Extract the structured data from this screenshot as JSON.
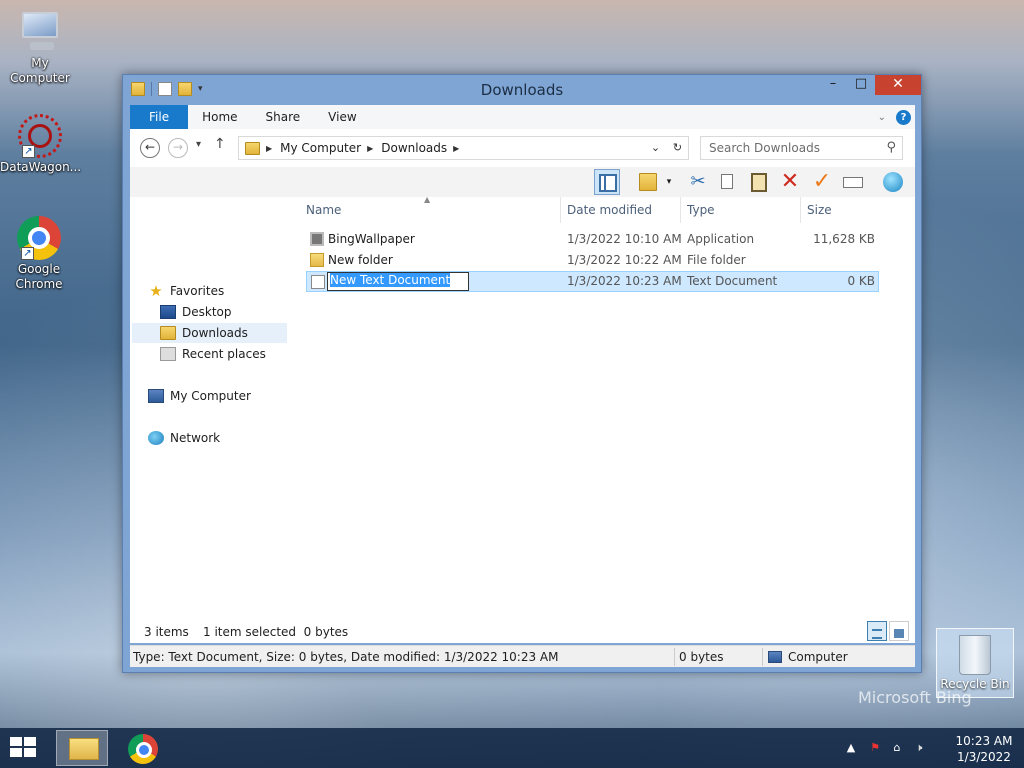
{
  "desktop": {
    "icons": [
      {
        "label": "My Computer"
      },
      {
        "label": "DataWagon..."
      },
      {
        "label": "Google Chrome"
      }
    ],
    "recycle_bin": "Recycle Bin",
    "watermark": "Microsoft Bing"
  },
  "window": {
    "title": "Downloads",
    "ribbon_tabs": [
      "File",
      "Home",
      "Share",
      "View"
    ],
    "address": {
      "crumbs": [
        "My Computer",
        "Downloads"
      ],
      "search_placeholder": "Search Downloads"
    },
    "nav": {
      "favorites": "Favorites",
      "items": [
        "Desktop",
        "Downloads",
        "Recent places"
      ],
      "computer": "My Computer",
      "network": "Network"
    },
    "columns": [
      "Name",
      "Date modified",
      "Type",
      "Size"
    ],
    "files": [
      {
        "name": "BingWallpaper",
        "date": "1/3/2022 10:10 AM",
        "type": "Application",
        "size": "11,628 KB"
      },
      {
        "name": "New folder",
        "date": "1/3/2022 10:22 AM",
        "type": "File folder",
        "size": ""
      },
      {
        "name": "New Text Document",
        "date": "1/3/2022 10:23 AM",
        "type": "Text Document",
        "size": "0 KB"
      }
    ],
    "status": {
      "items": "3 items",
      "selected": "1 item selected  0 bytes",
      "detail": "Type: Text Document, Size: 0 bytes, Date modified: 1/3/2022 10:23 AM",
      "bytes": "0 bytes",
      "location": "Computer"
    }
  },
  "taskbar": {
    "time": "10:23 AM",
    "date": "1/3/2022"
  }
}
